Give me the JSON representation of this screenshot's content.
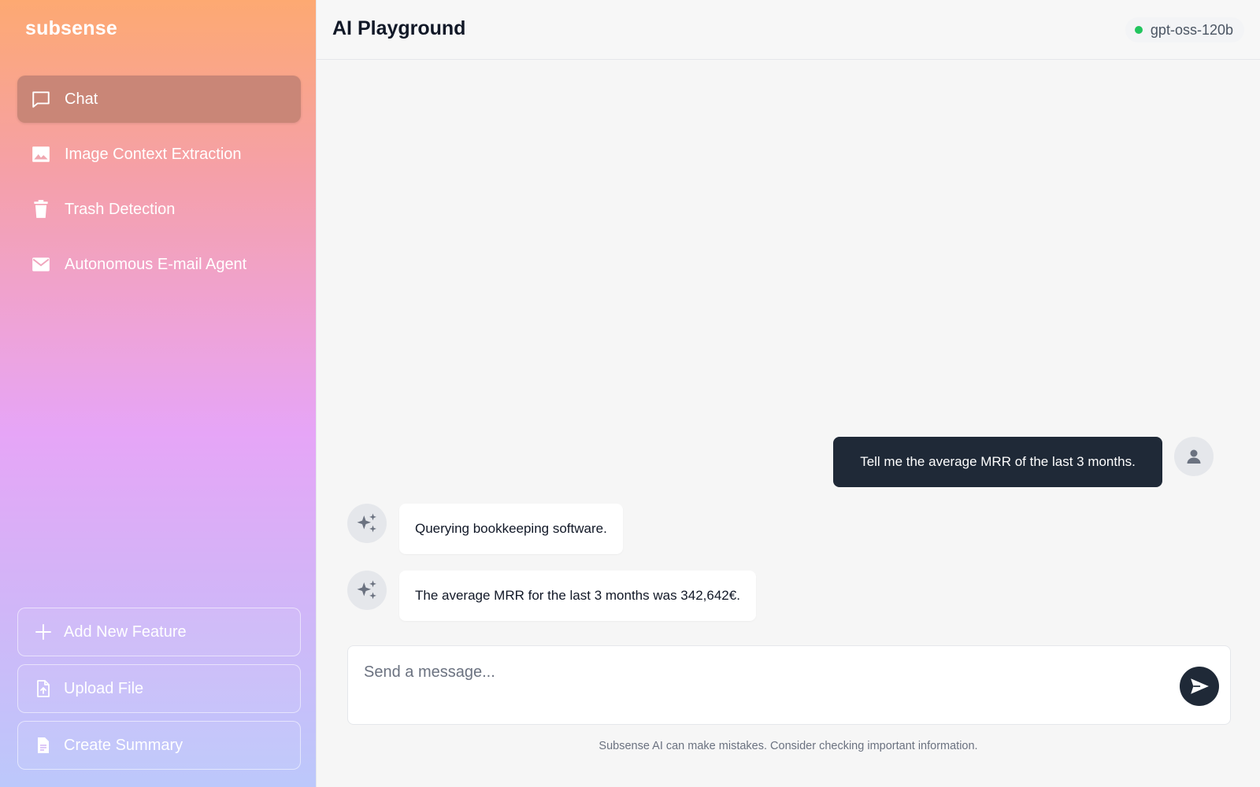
{
  "brand": "subsense",
  "sidebar": {
    "nav": [
      {
        "label": "Chat",
        "icon": "chat-bubble-icon",
        "active": true
      },
      {
        "label": "Image Context Extraction",
        "icon": "image-icon",
        "active": false
      },
      {
        "label": "Trash Detection",
        "icon": "trash-icon",
        "active": false
      },
      {
        "label": "Autonomous E-mail Agent",
        "icon": "mail-icon",
        "active": false
      }
    ],
    "actions": [
      {
        "label": "Add New Feature",
        "icon": "plus-icon"
      },
      {
        "label": "Upload File",
        "icon": "file-upload-icon"
      },
      {
        "label": "Create Summary",
        "icon": "document-icon"
      }
    ]
  },
  "header": {
    "title": "AI Playground",
    "model": "gpt-oss-120b",
    "model_status_color": "#22c55e"
  },
  "chat": {
    "messages": [
      {
        "role": "user",
        "text": "Tell me the average MRR of the last 3 months."
      },
      {
        "role": "assistant",
        "text": "Querying bookkeeping software."
      },
      {
        "role": "assistant",
        "text": "The average MRR for the last 3 months was 342,642€."
      }
    ],
    "composer_placeholder": "Send a message...",
    "disclaimer": "Subsense AI can make mistakes. Consider checking important information."
  },
  "colors": {
    "active_nav": "#c98677",
    "user_bubble": "#1f2937",
    "send_button": "#1f2937"
  }
}
